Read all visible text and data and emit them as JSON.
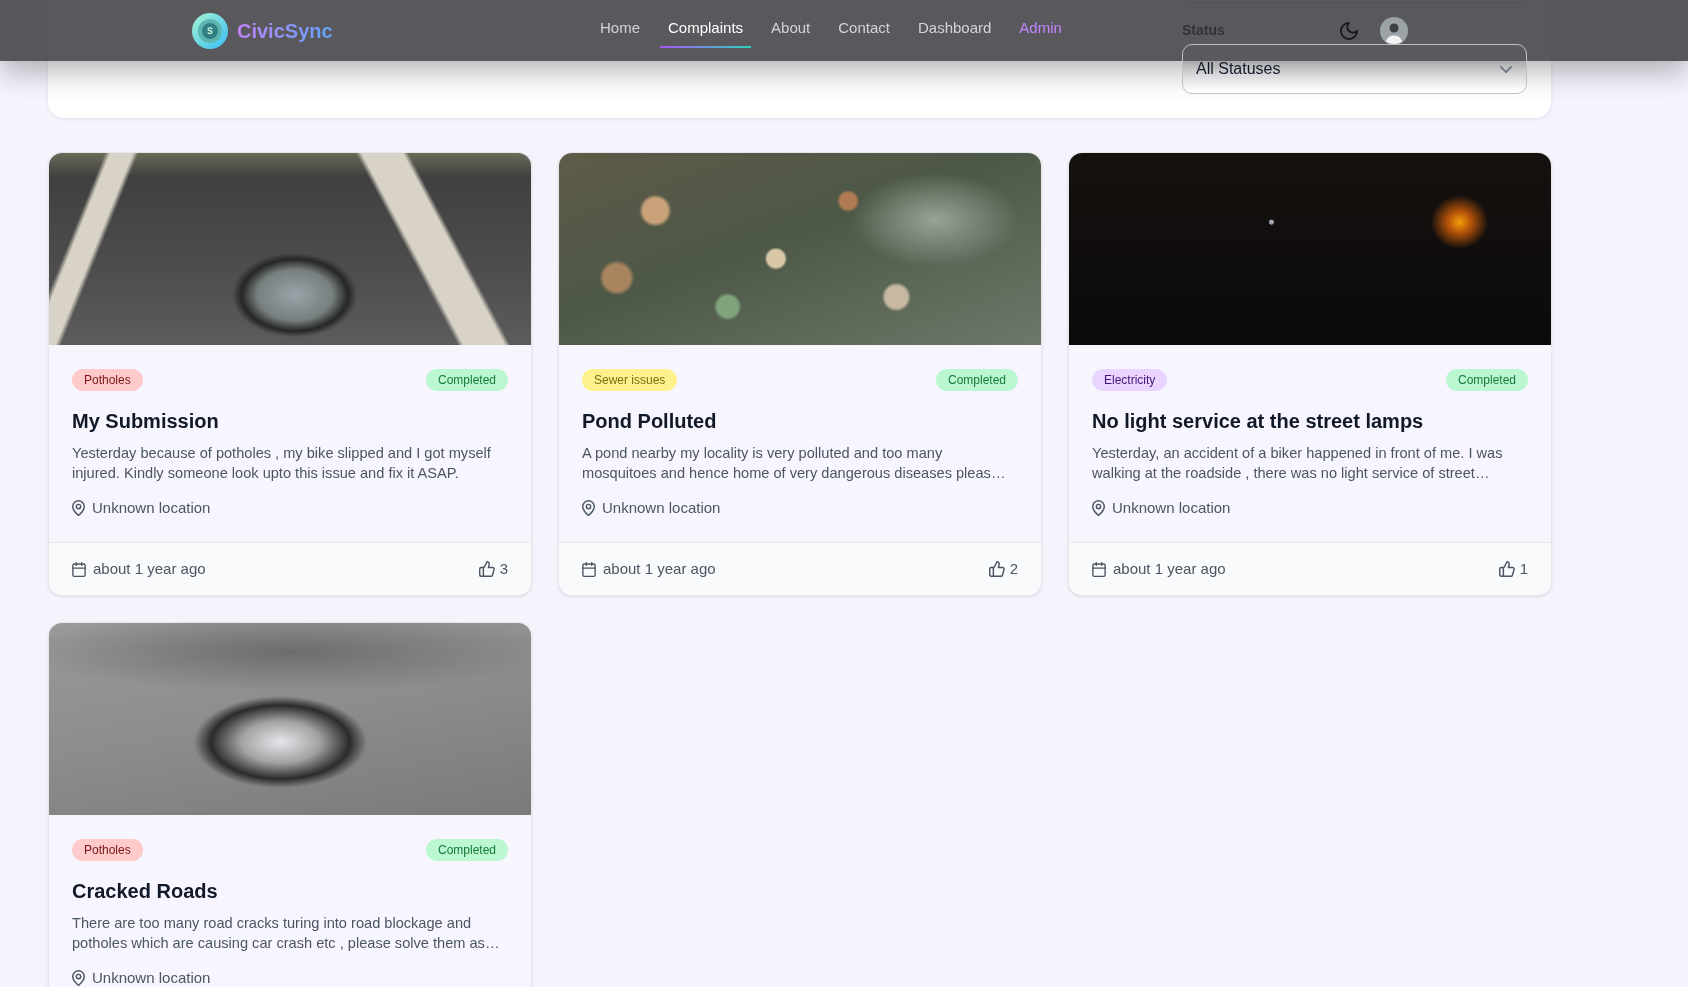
{
  "header": {
    "logo_text": "CivicSync",
    "nav": [
      {
        "label": "Home",
        "selected": false,
        "kind": "link"
      },
      {
        "label": "Complaints",
        "selected": true,
        "kind": "link"
      },
      {
        "label": "About",
        "selected": false,
        "kind": "link"
      },
      {
        "label": "Contact",
        "selected": false,
        "kind": "link"
      },
      {
        "label": "Dashboard",
        "selected": false,
        "kind": "link"
      },
      {
        "label": "Admin",
        "selected": false,
        "kind": "admin"
      }
    ]
  },
  "filters": {
    "status_label": "Status",
    "status_select": {
      "value": "All Statuses"
    }
  },
  "complaints": [
    {
      "photo": {
        "kind": "asphalt"
      },
      "category": {
        "label": "Potholes",
        "color": "#fecaca"
      },
      "status": {
        "label": "Completed",
        "color": "#bbf7d0"
      },
      "title": "My Submission",
      "description": "Yesterday because of potholes , my bike slipped and I got myself injured. Kindly someone look upto this issue and fix it ASAP.",
      "location": "Unknown location",
      "date": "about 1 year ago",
      "upvotes": "3"
    },
    {
      "photo": {
        "kind": "litter"
      },
      "category": {
        "label": "Sewer issues",
        "color": "#fef08a"
      },
      "status": {
        "label": "Completed",
        "color": "#bbf7d0"
      },
      "title": "Pond Polluted",
      "description": "A pond nearby my locality is very polluted and too many mosquitoes and hence home of very dangerous diseases pleas…",
      "location": "Unknown location",
      "date": "about 1 year ago",
      "upvotes": "2"
    },
    {
      "photo": {
        "kind": "night"
      },
      "category": {
        "label": "Electricity",
        "color": "#e9d5ff"
      },
      "status": {
        "label": "Completed",
        "color": "#bbf7d0"
      },
      "title": "No light service at the street lamps",
      "description": "Yesterday, an accident of a biker happened in front of me. I was walking at the roadside , there was no light service of street…",
      "location": "Unknown location",
      "date": "about 1 year ago",
      "upvotes": "1"
    },
    {
      "photo": {
        "kind": "gravel"
      },
      "category": {
        "label": "Potholes",
        "color": "#fecaca"
      },
      "status": {
        "label": "Completed",
        "color": "#bbf7d0"
      },
      "title": "Cracked Roads",
      "description": "There are too many road cracks turing into road blockage and potholes which are causing car crash etc , please solve them as…",
      "location": "Unknown location"
    }
  ]
}
